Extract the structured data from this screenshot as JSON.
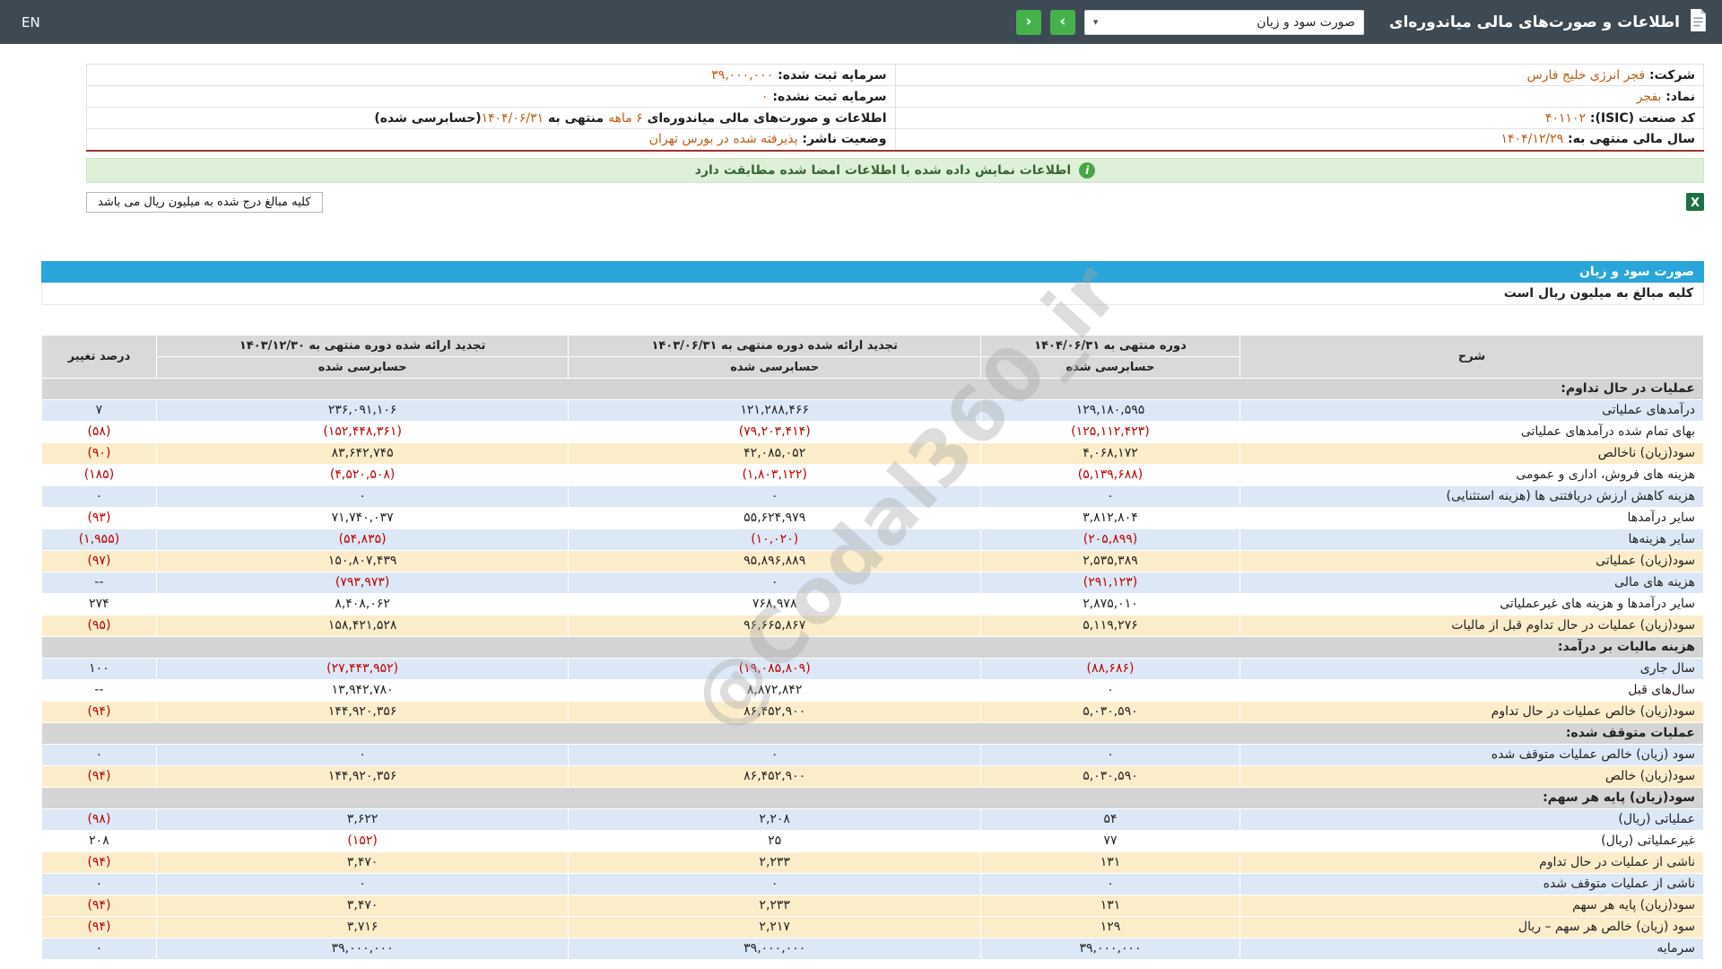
{
  "topbar": {
    "title": "اطلاعات و صورت‌های مالی میاندوره‌ای",
    "statement_select_value": "صورت سود و زیان",
    "en_label": "EN",
    "icons": {
      "dropdown_caret": "▾",
      "next_arrow": "›",
      "prev_arrow": "‹",
      "info": "i",
      "excel": "X"
    }
  },
  "company_info": {
    "rows": [
      {
        "right": [
          {
            "t": "شرکت: "
          },
          {
            "t": "فجر انرژی خلیج فارس",
            "accent": true
          }
        ],
        "left": [
          {
            "t": "سرمایه ثبت شده: "
          },
          {
            "t": "۳۹,۰۰۰,۰۰۰",
            "accent": true
          }
        ]
      },
      {
        "right": [
          {
            "t": "نماد: "
          },
          {
            "t": "بفجر",
            "accent": true
          }
        ],
        "left": [
          {
            "t": "سرمایه ثبت نشده: "
          },
          {
            "t": "۰",
            "accent": true
          }
        ]
      },
      {
        "right": [
          {
            "t": "کد صنعت (ISIC): "
          },
          {
            "t": "۴۰۱۱۰۲",
            "accent": true
          }
        ],
        "left": [
          {
            "t": "اطلاعات و صورت‌های مالی میاندوره‌ای "
          },
          {
            "t": "۶ ماهه",
            "accent": true
          },
          {
            "t": " منتهی به "
          },
          {
            "t": "۱۴۰۴/۰۶/۳۱",
            "accent": true
          },
          {
            "t": "(حسابرسی شده)"
          }
        ]
      },
      {
        "right": [
          {
            "t": "سال مالی منتهی به: "
          },
          {
            "t": "۱۴۰۴/۱۲/۲۹",
            "accent": true
          }
        ],
        "left": [
          {
            "t": "وضعیت ناشر: "
          },
          {
            "t": "پذیرفته شده در بورس تهران",
            "accent": true
          }
        ]
      }
    ]
  },
  "banner": {
    "text": "اطلاعات نمایش داده شده با اطلاعات امضا شده مطابقت دارد"
  },
  "unit_box": {
    "text": "کلیه مبالغ درج شده به میلیون ریال می باشد"
  },
  "statement": {
    "title": "صورت سود و زیان",
    "unit_note": "کلیه مبالغ به میلیون ریال است",
    "header": {
      "desc": "شرح",
      "period_current": "دوره منتهی به ۱۴۰۴/۰۶/۳۱",
      "period_prior": "تجدید ارائه شده دوره منتهی به ۱۴۰۳/۰۶/۳۱",
      "period_annual": "تجدید ارائه شده دوره منتهی به ۱۴۰۳/۱۲/۳۰",
      "audited": "حسابرسی شده",
      "pct_change": "درصد تغییر"
    },
    "rows": [
      {
        "type": "section",
        "desc": "عملیات در حال تداوم:"
      },
      {
        "style": "blue",
        "desc": "درآمدهای عملیاتی",
        "c1": "۱۲۹,۱۸۰,۵۹۵",
        "c2": "۱۲۱,۲۸۸,۴۶۶",
        "c3": "۲۳۶,۰۹۱,۱۰۶",
        "pct": "۷"
      },
      {
        "style": "white",
        "desc": "بهای تمام شده درآمدهای عملیاتی",
        "c1": "(۱۲۵,۱۱۲,۴۲۳)",
        "c2": "(۷۹,۲۰۳,۴۱۴)",
        "c3": "(۱۵۲,۴۴۸,۳۶۱)",
        "pct": "(۵۸)"
      },
      {
        "style": "yellow",
        "desc": "سود(زیان) ناخالص",
        "c1": "۴,۰۶۸,۱۷۲",
        "c2": "۴۲,۰۸۵,۰۵۲",
        "c3": "۸۳,۶۴۲,۷۴۵",
        "pct": "(۹۰)"
      },
      {
        "style": "white",
        "desc": "هزینه های فروش، اداری و عمومی",
        "c1": "(۵,۱۳۹,۶۸۸)",
        "c2": "(۱,۸۰۳,۱۲۲)",
        "c3": "(۴,۵۲۰,۵۰۸)",
        "pct": "(۱۸۵)"
      },
      {
        "style": "blue",
        "desc": "هزینه کاهش ارزش دریافتنی ها (هزینه استثنایی)",
        "c1": "۰",
        "c2": "۰",
        "c3": "۰",
        "pct": "۰"
      },
      {
        "style": "white",
        "desc": "سایر درآمدها",
        "c1": "۳,۸۱۲,۸۰۴",
        "c2": "۵۵,۶۲۴,۹۷۹",
        "c3": "۷۱,۷۴۰,۰۳۷",
        "pct": "(۹۳)"
      },
      {
        "style": "blue",
        "desc": "سایر هزینه‌ها",
        "c1": "(۲۰۵,۸۹۹)",
        "c2": "(۱۰,۰۲۰)",
        "c3": "(۵۴,۸۳۵)",
        "pct": "(۱,۹۵۵)"
      },
      {
        "style": "yellow",
        "desc": "سود(زیان) عملیاتی",
        "c1": "۲,۵۳۵,۳۸۹",
        "c2": "۹۵,۸۹۶,۸۸۹",
        "c3": "۱۵۰,۸۰۷,۴۳۹",
        "pct": "(۹۷)"
      },
      {
        "style": "blue",
        "desc": "هزینه های مالی",
        "c1": "(۲۹۱,۱۲۳)",
        "c2": "۰",
        "c3": "(۷۹۳,۹۷۳)",
        "pct": "--"
      },
      {
        "style": "white",
        "desc": "سایر درآمدها و هزینه های غیرعملیاتی",
        "c1": "۲,۸۷۵,۰۱۰",
        "c2": "۷۶۸,۹۷۸",
        "c3": "۸,۴۰۸,۰۶۲",
        "pct": "۲۷۴"
      },
      {
        "style": "yellow",
        "desc": "سود(زیان) عملیات در حال تداوم قبل از مالیات",
        "c1": "۵,۱۱۹,۲۷۶",
        "c2": "۹۶,۶۶۵,۸۶۷",
        "c3": "۱۵۸,۴۲۱,۵۲۸",
        "pct": "(۹۵)"
      },
      {
        "type": "section",
        "desc": "هزینه مالیات بر درآمد:"
      },
      {
        "style": "blue",
        "desc": "سال جاری",
        "c1": "(۸۸,۶۸۶)",
        "c2": "(۱۹,۰۸۵,۸۰۹)",
        "c3": "(۲۷,۴۴۳,۹۵۲)",
        "pct": "۱۰۰"
      },
      {
        "style": "white",
        "desc": "سال‌های قبل",
        "c1": "۰",
        "c2": "۸,۸۷۲,۸۴۲",
        "c3": "۱۳,۹۴۲,۷۸۰",
        "pct": "--"
      },
      {
        "style": "yellow",
        "desc": "سود(زیان) خالص عملیات در حال تداوم",
        "c1": "۵,۰۳۰,۵۹۰",
        "c2": "۸۶,۴۵۲,۹۰۰",
        "c3": "۱۴۴,۹۲۰,۳۵۶",
        "pct": "(۹۴)"
      },
      {
        "type": "section",
        "desc": "عملیات متوقف شده:"
      },
      {
        "style": "blue",
        "desc": "سود (زیان) خالص عملیات متوقف شده",
        "c1": "۰",
        "c2": "۰",
        "c3": "۰",
        "pct": "۰"
      },
      {
        "style": "yellow",
        "desc": "سود(زیان) خالص",
        "c1": "۵,۰۳۰,۵۹۰",
        "c2": "۸۶,۴۵۲,۹۰۰",
        "c3": "۱۴۴,۹۲۰,۳۵۶",
        "pct": "(۹۴)"
      },
      {
        "type": "section",
        "desc": "سود(زیان) پایه هر سهم:"
      },
      {
        "style": "blue",
        "desc": "عملیاتی (ریال)",
        "c1": "۵۴",
        "c2": "۲,۲۰۸",
        "c3": "۳,۶۲۲",
        "pct": "(۹۸)"
      },
      {
        "style": "white",
        "desc": "غیرعملیاتی (ریال)",
        "c1": "۷۷",
        "c2": "۲۵",
        "c3": "(۱۵۲)",
        "pct": "۲۰۸"
      },
      {
        "style": "yellow",
        "desc": "ناشی از عملیات در حال تداوم",
        "c1": "۱۳۱",
        "c2": "۲,۲۳۳",
        "c3": "۳,۴۷۰",
        "pct": "(۹۴)"
      },
      {
        "style": "blue",
        "desc": "ناشی از عملیات متوقف شده",
        "c1": "۰",
        "c2": "۰",
        "c3": "۰",
        "pct": "۰"
      },
      {
        "style": "yellow",
        "desc": "سود(زیان) پایه هر سهم",
        "c1": "۱۳۱",
        "c2": "۲,۲۳۳",
        "c3": "۳,۴۷۰",
        "pct": "(۹۴)"
      },
      {
        "style": "yellow",
        "desc": "سود (زیان) خالص هر سهم – ریال",
        "c1": "۱۲۹",
        "c2": "۲,۲۱۷",
        "c3": "۳,۷۱۶",
        "pct": "(۹۴)"
      },
      {
        "style": "blue",
        "desc": "سرمایه",
        "c1": "۳۹,۰۰۰,۰۰۰",
        "c2": "۳۹,۰۰۰,۰۰۰",
        "c3": "۳۹,۰۰۰,۰۰۰",
        "pct": "۰"
      }
    ]
  },
  "watermark": "@Codal360_ir",
  "colors": {
    "topbar": "#3d4a54",
    "nav_button_green": "#45b14b",
    "section_bar_blue": "#2aa5da",
    "accent_value_orange": "#bf5a15",
    "negative_red": "#c00000",
    "row_blue": "#dce8f6",
    "row_highlight_yellow": "#fcedca",
    "row_section_gray": "#d4d4d4",
    "success_banner_bg": "#dff0d8"
  }
}
